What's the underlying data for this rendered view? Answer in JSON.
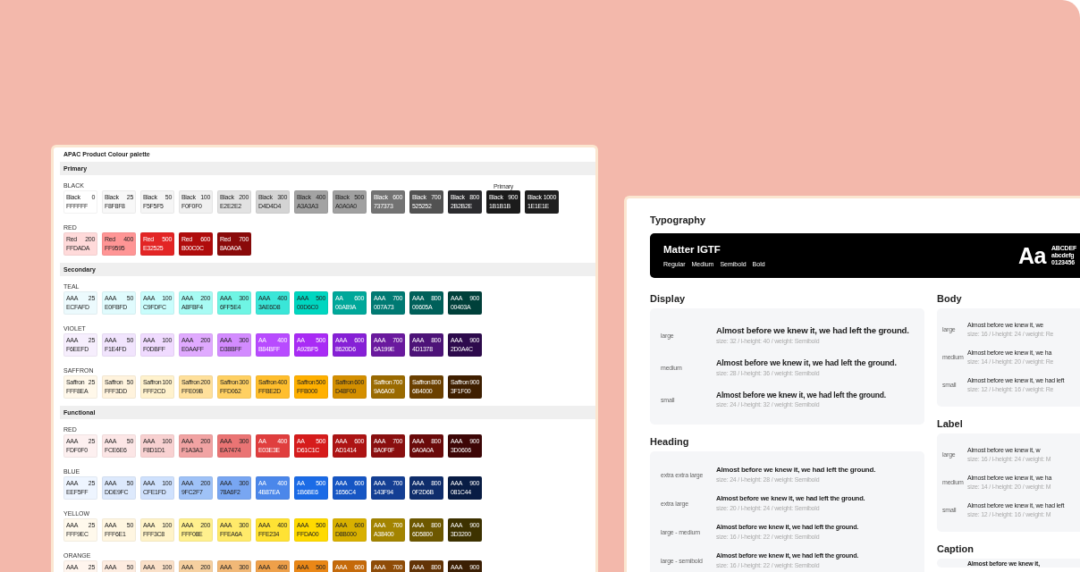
{
  "palette": {
    "title": "APAC Product Colour palette",
    "sections": [
      {
        "name": "Primary",
        "groups": [
          {
            "name": "BLACK",
            "swatches": [
              {
                "name": "Black",
                "step": "0",
                "hex": "FFFFFF",
                "color": "#ffffff"
              },
              {
                "name": "Black",
                "step": "25",
                "hex": "F8F8F8",
                "color": "#f8f8f8"
              },
              {
                "name": "Black",
                "step": "50",
                "hex": "F5F5F5",
                "color": "#f5f5f5"
              },
              {
                "name": "Black",
                "step": "100",
                "hex": "F0F0F0",
                "color": "#f0f0f0"
              },
              {
                "name": "Black",
                "step": "200",
                "hex": "E2E2E2",
                "color": "#e2e2e2"
              },
              {
                "name": "Black",
                "step": "300",
                "hex": "D4D4D4",
                "color": "#d4d4d4"
              },
              {
                "name": "Black",
                "step": "400",
                "hex": "A3A3A3",
                "color": "#a3a3a3"
              },
              {
                "name": "Black",
                "step": "500",
                "hex": "A0A0A0",
                "color": "#a0a0a0"
              },
              {
                "name": "Black",
                "step": "600",
                "hex": "737373",
                "color": "#737373"
              },
              {
                "name": "Black",
                "step": "700",
                "hex": "525252",
                "color": "#525252"
              },
              {
                "name": "Black",
                "step": "800",
                "hex": "2B2B2E",
                "color": "#2b2b2e"
              },
              {
                "name": "Black",
                "step": "900",
                "hex": "1B1B1B",
                "color": "#1b1b1b",
                "tag": "Primary"
              },
              {
                "name": "Black",
                "step": "1000",
                "hex": "1E1E1E",
                "color": "#1e1e1e"
              }
            ]
          },
          {
            "name": "RED",
            "swatches": [
              {
                "name": "Red",
                "step": "200",
                "hex": "FFDADA",
                "color": "#ffdada"
              },
              {
                "name": "Red",
                "step": "400",
                "hex": "FF9595",
                "color": "#ff9595"
              },
              {
                "name": "Red",
                "step": "500",
                "hex": "E32525",
                "color": "#e32525"
              },
              {
                "name": "Red",
                "step": "600",
                "hex": "B00C0C",
                "color": "#b00c0c"
              },
              {
                "name": "Red",
                "step": "700",
                "hex": "8A0A0A",
                "color": "#8a0a0a"
              }
            ]
          }
        ]
      },
      {
        "name": "Secondary",
        "groups": [
          {
            "name": "TEAL",
            "swatches": [
              {
                "name": "AAA",
                "step": "25",
                "hex": "ECFAFD",
                "color": "#ecfafd"
              },
              {
                "name": "AAA",
                "step": "50",
                "hex": "E0FBFD",
                "color": "#e0fbfd"
              },
              {
                "name": "AAA",
                "step": "100",
                "hex": "C9FDFC",
                "color": "#c9fdfc"
              },
              {
                "name": "AAA",
                "step": "200",
                "hex": "A8FBF4",
                "color": "#a8fbf4"
              },
              {
                "name": "AAA",
                "step": "300",
                "hex": "6FF5E4",
                "color": "#6ff5e4"
              },
              {
                "name": "AAA",
                "step": "400",
                "hex": "3AE6D8",
                "color": "#3ae6d8"
              },
              {
                "name": "AAA",
                "step": "500",
                "hex": "00D6C0",
                "color": "#00d6c0"
              },
              {
                "name": "AA",
                "step": "600",
                "hex": "00A89A",
                "color": "#00a89a"
              },
              {
                "name": "AAA",
                "step": "700",
                "hex": "007A73",
                "color": "#007a73"
              },
              {
                "name": "AAA",
                "step": "800",
                "hex": "00605A",
                "color": "#00605a"
              },
              {
                "name": "AAA",
                "step": "900",
                "hex": "00403A",
                "color": "#00403a"
              }
            ]
          },
          {
            "name": "VIOLET",
            "swatches": [
              {
                "name": "AAA",
                "step": "25",
                "hex": "F6EEFD",
                "color": "#f6eefd"
              },
              {
                "name": "AAA",
                "step": "50",
                "hex": "F1E4FD",
                "color": "#f1e4fd"
              },
              {
                "name": "AAA",
                "step": "100",
                "hex": "F0DBFF",
                "color": "#f0dbff"
              },
              {
                "name": "AAA",
                "step": "200",
                "hex": "E0AAFF",
                "color": "#e0aaff"
              },
              {
                "name": "AAA",
                "step": "300",
                "hex": "D38BFF",
                "color": "#d38bff"
              },
              {
                "name": "AA",
                "step": "400",
                "hex": "B84BFF",
                "color": "#b84bff"
              },
              {
                "name": "AA",
                "step": "500",
                "hex": "A92BF5",
                "color": "#a92bf5"
              },
              {
                "name": "AAA",
                "step": "600",
                "hex": "8620D6",
                "color": "#8620d6"
              },
              {
                "name": "AAA",
                "step": "700",
                "hex": "6A199E",
                "color": "#6a199e"
              },
              {
                "name": "AAA",
                "step": "800",
                "hex": "4D1378",
                "color": "#4d1378"
              },
              {
                "name": "AAA",
                "step": "900",
                "hex": "2D0A4C",
                "color": "#2d0a4c"
              }
            ]
          },
          {
            "name": "SAFFRON",
            "swatches": [
              {
                "name": "Saffron",
                "step": "25",
                "hex": "FFF8EA",
                "color": "#fff8ea"
              },
              {
                "name": "Saffron",
                "step": "50",
                "hex": "FFF3DD",
                "color": "#fff3dd"
              },
              {
                "name": "Saffron",
                "step": "100",
                "hex": "FFF2CD",
                "color": "#fff2cd"
              },
              {
                "name": "Saffron",
                "step": "200",
                "hex": "FFE09B",
                "color": "#ffe09b"
              },
              {
                "name": "Saffron",
                "step": "300",
                "hex": "FFD062",
                "color": "#ffd062"
              },
              {
                "name": "Saffron",
                "step": "400",
                "hex": "FFBE2D",
                "color": "#ffbe2d"
              },
              {
                "name": "Saffron",
                "step": "500",
                "hex": "FFB000",
                "color": "#ffb000"
              },
              {
                "name": "Saffron",
                "step": "600",
                "hex": "D48F00",
                "color": "#d48f00"
              },
              {
                "name": "Saffron",
                "step": "700",
                "hex": "9A6A00",
                "color": "#9a6a00"
              },
              {
                "name": "Saffron",
                "step": "800",
                "hex": "6B4000",
                "color": "#6b4000"
              },
              {
                "name": "Saffron",
                "step": "900",
                "hex": "3F1F00",
                "color": "#3f1f00"
              }
            ]
          }
        ]
      },
      {
        "name": "Functional",
        "groups": [
          {
            "name": "RED",
            "swatches": [
              {
                "name": "AAA",
                "step": "25",
                "hex": "FDF0F0",
                "color": "#fdf0f0"
              },
              {
                "name": "AAA",
                "step": "50",
                "hex": "FCE6E6",
                "color": "#fce6e6"
              },
              {
                "name": "AAA",
                "step": "100",
                "hex": "F8D1D1",
                "color": "#f8d1d1"
              },
              {
                "name": "AAA",
                "step": "200",
                "hex": "F1A3A3",
                "color": "#f1a3a3"
              },
              {
                "name": "AAA",
                "step": "300",
                "hex": "EA7474",
                "color": "#ea7474"
              },
              {
                "name": "AA",
                "step": "400",
                "hex": "E03E3E",
                "color": "#e03e3e"
              },
              {
                "name": "AA",
                "step": "500",
                "hex": "D61C1C",
                "color": "#d61c1c"
              },
              {
                "name": "AAA",
                "step": "600",
                "hex": "AD1414",
                "color": "#ad1414"
              },
              {
                "name": "AAA",
                "step": "700",
                "hex": "8A0F0F",
                "color": "#8a0f0f"
              },
              {
                "name": "AAA",
                "step": "800",
                "hex": "6A0A0A",
                "color": "#6a0a0a"
              },
              {
                "name": "AAA",
                "step": "900",
                "hex": "3D0606",
                "color": "#3d0606"
              }
            ]
          },
          {
            "name": "BLUE",
            "swatches": [
              {
                "name": "AAA",
                "step": "25",
                "hex": "EEF5FF",
                "color": "#eef5ff"
              },
              {
                "name": "AAA",
                "step": "50",
                "hex": "DDE9FC",
                "color": "#dde9fc"
              },
              {
                "name": "AAA",
                "step": "100",
                "hex": "CFE1FD",
                "color": "#cfe1fd"
              },
              {
                "name": "AAA",
                "step": "200",
                "hex": "9FC2F7",
                "color": "#9fc2f7"
              },
              {
                "name": "AAA",
                "step": "300",
                "hex": "78A6F2",
                "color": "#78a6f2"
              },
              {
                "name": "AA",
                "step": "400",
                "hex": "4B87EA",
                "color": "#4b87ea"
              },
              {
                "name": "AA",
                "step": "500",
                "hex": "1B6BE6",
                "color": "#1b6be6"
              },
              {
                "name": "AAA",
                "step": "600",
                "hex": "1656C4",
                "color": "#1656c4"
              },
              {
                "name": "AAA",
                "step": "700",
                "hex": "143F94",
                "color": "#143f94"
              },
              {
                "name": "AAA",
                "step": "800",
                "hex": "0F2D6B",
                "color": "#0f2d6b"
              },
              {
                "name": "AAA",
                "step": "900",
                "hex": "081C44",
                "color": "#081c44"
              }
            ]
          },
          {
            "name": "YELLOW",
            "swatches": [
              {
                "name": "AAA",
                "step": "25",
                "hex": "FFF9EC",
                "color": "#fff9ec"
              },
              {
                "name": "AAA",
                "step": "50",
                "hex": "FFF6E1",
                "color": "#fff6e1"
              },
              {
                "name": "AAA",
                "step": "100",
                "hex": "FFF3C8",
                "color": "#fff3c8"
              },
              {
                "name": "AAA",
                "step": "200",
                "hex": "FFF08E",
                "color": "#fff08e"
              },
              {
                "name": "AAA",
                "step": "300",
                "hex": "FFEA6A",
                "color": "#ffea6a"
              },
              {
                "name": "AAA",
                "step": "400",
                "hex": "FFE234",
                "color": "#ffe234"
              },
              {
                "name": "AAA",
                "step": "500",
                "hex": "FFDA00",
                "color": "#ffda00"
              },
              {
                "name": "AAA",
                "step": "600",
                "hex": "D8B000",
                "color": "#d8b000"
              },
              {
                "name": "AAA",
                "step": "700",
                "hex": "A38400",
                "color": "#a38400"
              },
              {
                "name": "AAA",
                "step": "800",
                "hex": "6D5800",
                "color": "#6d5800"
              },
              {
                "name": "AAA",
                "step": "900",
                "hex": "3D3200",
                "color": "#3d3200"
              }
            ]
          },
          {
            "name": "ORANGE",
            "swatches": [
              {
                "name": "AAA",
                "step": "25",
                "color": "#fff5ee"
              },
              {
                "name": "AAA",
                "step": "50",
                "color": "#fdece0"
              },
              {
                "name": "AAA",
                "step": "100",
                "color": "#fae0c8"
              },
              {
                "name": "AAA",
                "step": "200",
                "color": "#f6d0a0"
              },
              {
                "name": "AAA",
                "step": "300",
                "color": "#f1b877"
              },
              {
                "name": "AAA",
                "step": "400",
                "color": "#eea04a"
              },
              {
                "name": "AAA",
                "step": "500",
                "color": "#ea8716"
              },
              {
                "name": "AAA",
                "step": "600",
                "color": "#c56a0a"
              },
              {
                "name": "AAA",
                "step": "700",
                "color": "#8f4c07"
              },
              {
                "name": "AAA",
                "step": "800",
                "color": "#633406"
              },
              {
                "name": "AAA",
                "step": "900",
                "color": "#3b1f04"
              }
            ]
          }
        ]
      }
    ]
  },
  "typography": {
    "title": "Typography",
    "font": {
      "name": "Matter IGTF",
      "weights": [
        "Regular",
        "Medium",
        "Semibold",
        "Bold"
      ],
      "sample": "Aa",
      "glyphs": [
        "ABCDEF",
        "abcdefg",
        "0123456"
      ]
    },
    "columns": [
      {
        "panels": [
          {
            "kind": "display",
            "title": "Display",
            "rows": [
              {
                "label": "large",
                "sample": "Almost before we knew it, we had left the ground.",
                "meta": "size: 32 / l-height: 40 / weight: Semibold"
              },
              {
                "label": "medium",
                "sample": "Almost before we knew it, we had left the ground.",
                "meta": "size: 28 / l-height: 36 / weight: Semibold"
              },
              {
                "label": "small",
                "sample": "Almost before we knew it, we had left the ground.",
                "meta": "size: 24 / l-height: 32 / weight: Semibold"
              }
            ]
          },
          {
            "kind": "heading",
            "title": "Heading",
            "rows": [
              {
                "label": "extra extra large",
                "sample": "Almost before we knew it, we had left the ground.",
                "meta": "size: 24 / l-height: 28 / weight: Semibold"
              },
              {
                "label": "extra large",
                "sample": "Almost before we knew it, we had left the ground.",
                "meta": "size: 20 / l-height: 24 / weight: Semibold"
              },
              {
                "label": "large - medium",
                "sample": "Almost before we knew it, we had left the ground.",
                "meta": "size: 16 / l-height: 22 / weight: Semibold"
              },
              {
                "label": "large - semibold",
                "sample": "Almost before we knew it, we had left the ground.",
                "meta": "size: 16 / l-height: 22 / weight: Semibold"
              }
            ]
          }
        ]
      },
      {
        "panels": [
          {
            "kind": "body",
            "title": "Body",
            "rows": [
              {
                "label": "large",
                "sample": "Almost before we knew it, we",
                "meta": "size: 16 / l-height: 24 / weight: Re"
              },
              {
                "label": "medium",
                "sample": "Almost before we knew it, we ha",
                "meta": "size: 14 / l-height: 20 / weight: Re"
              },
              {
                "label": "small",
                "sample": "Almost before we knew it, we had left",
                "meta": "size: 12 / l-height: 16 / weight: Re"
              }
            ]
          },
          {
            "kind": "body",
            "title": "Label",
            "rows": [
              {
                "label": "large",
                "sample": "Almost before we knew it, w",
                "meta": "size: 16 / l-height: 24 / weight: M"
              },
              {
                "label": "medium",
                "sample": "Almost before we knew it, we ha",
                "meta": "size: 14 / l-height: 20 / weight: M"
              },
              {
                "label": "small",
                "sample": "Almost before we knew it, we had left",
                "meta": "size: 12 / l-height: 16 / weight: M"
              }
            ]
          },
          {
            "kind": "caption",
            "title": "Caption",
            "rows": [
              {
                "sample": "Almost before we knew it,"
              }
            ]
          }
        ]
      }
    ]
  }
}
